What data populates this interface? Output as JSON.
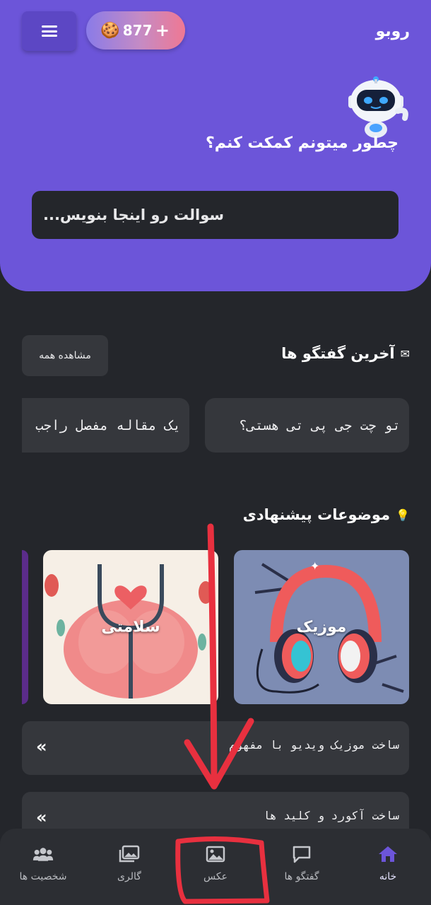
{
  "header": {
    "brand": "روبو",
    "credits": "877",
    "credit_plus": "+",
    "help_title": "چطور میتونم کمکت کنم؟",
    "search_placeholder": "سوالت رو اینجا بنویس..."
  },
  "recent": {
    "title": "آخرین گفتگو ها",
    "view_all": "مشاهده همه",
    "items": [
      {
        "text": "تو چت جی پی تی هستی؟"
      },
      {
        "text": "یک مقاله مفصل راجب"
      }
    ]
  },
  "suggested": {
    "title": "موضوعات پیشنهادی",
    "topics": [
      {
        "label": "موزیک"
      },
      {
        "label": "سلامتی"
      }
    ],
    "prompts": [
      {
        "text": "ساخت موزیک ویدیو با مفهوم"
      },
      {
        "text": "ساخت آکورد و کلید ها"
      }
    ]
  },
  "nav": {
    "items": [
      {
        "label": "خانه",
        "icon": "home-icon",
        "active": true
      },
      {
        "label": "گفتگو ها",
        "icon": "chat-icon",
        "active": false
      },
      {
        "label": "عکس",
        "icon": "image-icon",
        "active": false
      },
      {
        "label": "گالری",
        "icon": "gallery-icon",
        "active": false
      },
      {
        "label": "شخصیت ها",
        "icon": "users-icon",
        "active": false
      }
    ]
  },
  "colors": {
    "accent": "#6c55d9",
    "background": "#24262b",
    "card": "#35373c",
    "annotation": "#e8303f"
  }
}
